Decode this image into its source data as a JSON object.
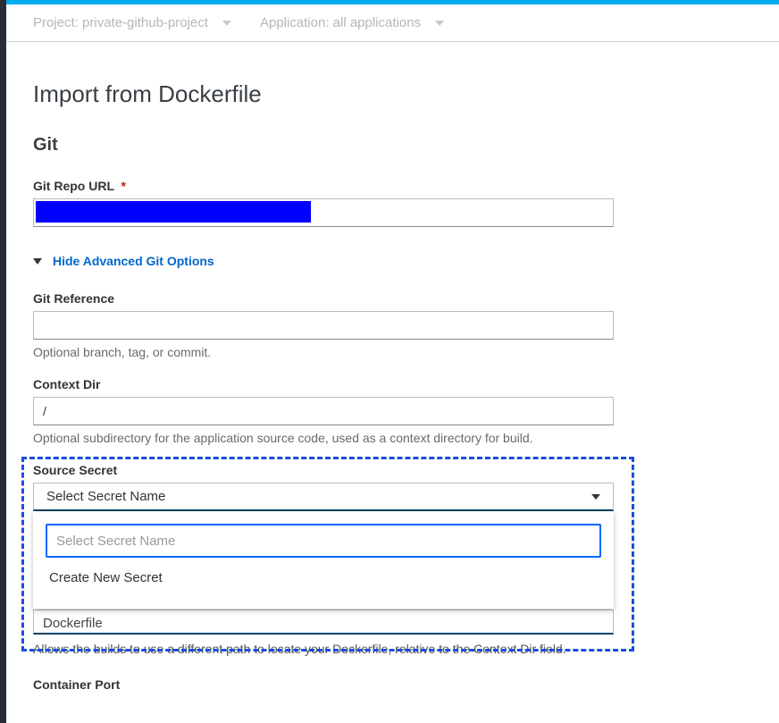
{
  "projectBar": {
    "project": "Project: private-github-project",
    "application": "Application: all applications"
  },
  "pageTitle": "Import from Dockerfile",
  "sectionTitle": "Git",
  "gitRepo": {
    "label": "Git Repo URL",
    "value_selection": ""
  },
  "advToggle": "Hide Advanced Git Options",
  "gitRef": {
    "label": "Git Reference",
    "value": "",
    "help": "Optional branch, tag, or commit."
  },
  "contextDir": {
    "label": "Context Dir",
    "value": "/",
    "help": "Optional subdirectory for the application source code, used as a context directory for build."
  },
  "sourceSecret": {
    "label": "Source Secret",
    "selected": "Select Secret Name",
    "searchPlaceholder": "Select Secret Name",
    "option_create": "Create New Secret"
  },
  "dockerfile": {
    "value": "Dockerfile",
    "help": "Allows the builds to use a different path to locate your Dockerfile, relative to the Context Dir field."
  },
  "containerPort": {
    "label": "Container Port"
  }
}
